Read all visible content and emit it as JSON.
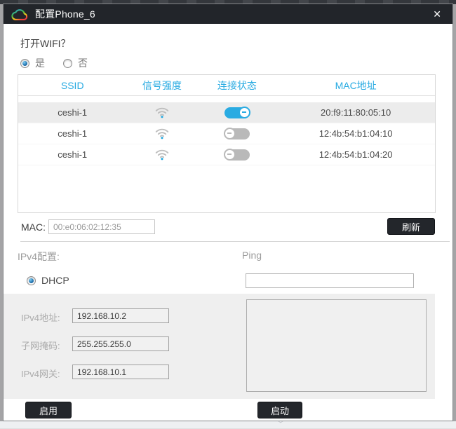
{
  "window": {
    "title": "配置Phone_6",
    "close_glyph": "✕"
  },
  "wifi": {
    "question": "打开WIFI？",
    "yes_label": "是",
    "no_label": "否"
  },
  "table": {
    "headers": {
      "ssid": "SSID",
      "signal": "信号强度",
      "status": "连接状态",
      "mac": "MAC地址"
    },
    "rows": [
      {
        "ssid": "ceshi-1",
        "mac": "20:f9:11:80:05:10",
        "connected": "on"
      },
      {
        "ssid": "ceshi-1",
        "mac": "12:4b:54:b1:04:10",
        "connected": "off"
      },
      {
        "ssid": "ceshi-1",
        "mac": "12:4b:54:b1:04:20",
        "connected": "off"
      }
    ]
  },
  "mac": {
    "label": "MAC:",
    "value": "00:e0:06:02:12:35",
    "refresh": "刷新"
  },
  "ipv4": {
    "section_label": "IPv4配置:",
    "dhcp_label": "DHCP",
    "ping_label": "Ping",
    "ping_value": "",
    "address_label": "IPv4地址:",
    "address_value": "192.168.10.2",
    "mask_label": "子网掩码:",
    "mask_value": "255.255.255.0",
    "gateway_label": "IPv4网关:",
    "gateway_value": "192.168.10.1"
  },
  "footer": {
    "enable": "启用",
    "start": "启动"
  },
  "icons": {
    "cloud": "cloud-icon",
    "wifi": "wifi-signal-icon",
    "close": "close-icon",
    "chevron": "﹀"
  },
  "colors": {
    "accent": "#29abe2",
    "titlebar": "#22252a",
    "dark_button": "#23262b",
    "selected_row": "#ececec",
    "panel": "#efefef"
  }
}
